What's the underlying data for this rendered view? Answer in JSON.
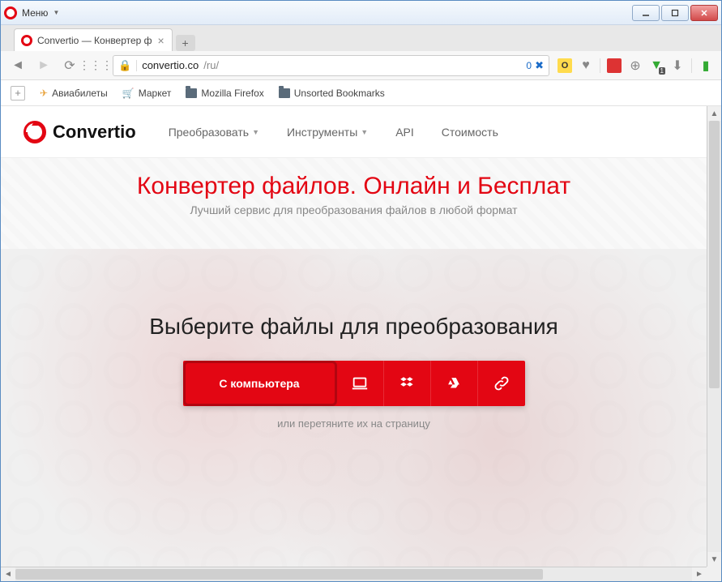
{
  "window": {
    "menu_label": "Меню"
  },
  "tab": {
    "title": "Convertio — Конвертер ф"
  },
  "address": {
    "host": "convertio.co",
    "path": "/ru/",
    "badge": "0"
  },
  "bookmarks": {
    "items": [
      {
        "label": "Авиабилеты"
      },
      {
        "label": "Маркет"
      },
      {
        "label": "Mozilla Firefox"
      },
      {
        "label": "Unsorted Bookmarks"
      }
    ]
  },
  "site": {
    "brand": "Convertio",
    "nav": {
      "convert": "Преобразовать",
      "tools": "Инструменты",
      "api": "API",
      "pricing": "Стоимость"
    }
  },
  "hero": {
    "title": "Конвертер файлов. Онлайн и Бесплат",
    "subtitle": "Лучший сервис для преобразования файлов в любой формат"
  },
  "dropzone": {
    "heading": "Выберите файлы для преобразования",
    "from_computer": "С компьютера",
    "drag_hint": "или перетяните их на страницу"
  }
}
